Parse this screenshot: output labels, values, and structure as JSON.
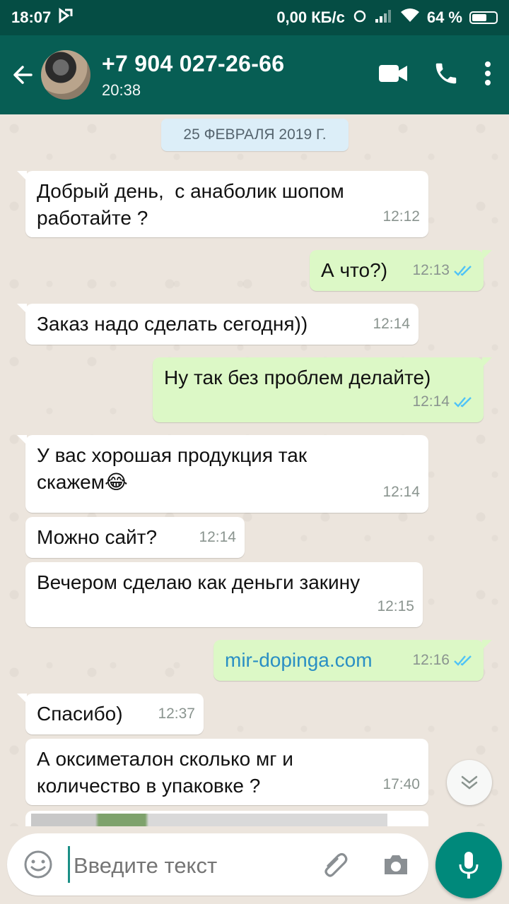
{
  "status_bar": {
    "time": "18:07",
    "network_speed": "0,00 КБ/с",
    "battery": "64 %",
    "battery_level": 0.64,
    "icons": [
      "notification-icon",
      "alarm-icon",
      "signal-icon",
      "wifi-icon",
      "battery-icon"
    ]
  },
  "header": {
    "contact_name": "+7 904 027-26-66",
    "last_seen": "20:38",
    "icons": [
      "back-arrow-icon",
      "avatar",
      "video-call-icon",
      "phone-icon",
      "more-vert-icon"
    ]
  },
  "chat": {
    "date_chip": "25 ФЕВРАЛЯ 2019 Г.",
    "messages": [
      {
        "direction": "in",
        "text": "Добрый день,  с анаболик шопом\nработайте ?",
        "time": "12:12"
      },
      {
        "direction": "out",
        "text": "А что?)",
        "time": "12:13",
        "status": "read"
      },
      {
        "direction": "in",
        "text": "Заказ надо сделать сегодня))",
        "time": "12:14"
      },
      {
        "direction": "out",
        "text": "Ну так без проблем делайте)",
        "time": "12:14",
        "status": "read"
      },
      {
        "direction": "in",
        "text": "У вас хорошая продукция так\nскажем",
        "emoji": "😂",
        "time": "12:14"
      },
      {
        "direction": "in",
        "text": "Можно сайт?",
        "time": "12:14"
      },
      {
        "direction": "in",
        "text": "Вечером сделаю как деньги закину",
        "time": "12:15"
      },
      {
        "direction": "out",
        "text": "mir-dopinga.com",
        "time": "12:16",
        "status": "read",
        "is_link": true
      },
      {
        "direction": "in",
        "text": "Спасибо)",
        "time": "12:37"
      },
      {
        "direction": "in",
        "text": "А оксиметалон сколько мг и\nколичество в упаковке ?",
        "time": "17:40"
      }
    ]
  },
  "composer": {
    "placeholder": "Введите текст",
    "icons": [
      "emoji-icon",
      "attach-icon",
      "camera-icon",
      "mic-icon"
    ]
  },
  "colors": {
    "app_bar": "#075E54",
    "status_bar": "#054D44",
    "outgoing_bubble": "#DCF8C6",
    "incoming_bubble": "#FFFFFF",
    "chat_background": "#ECE5DD",
    "read_ticks": "#4FC3F7",
    "fab": "#00897B"
  }
}
